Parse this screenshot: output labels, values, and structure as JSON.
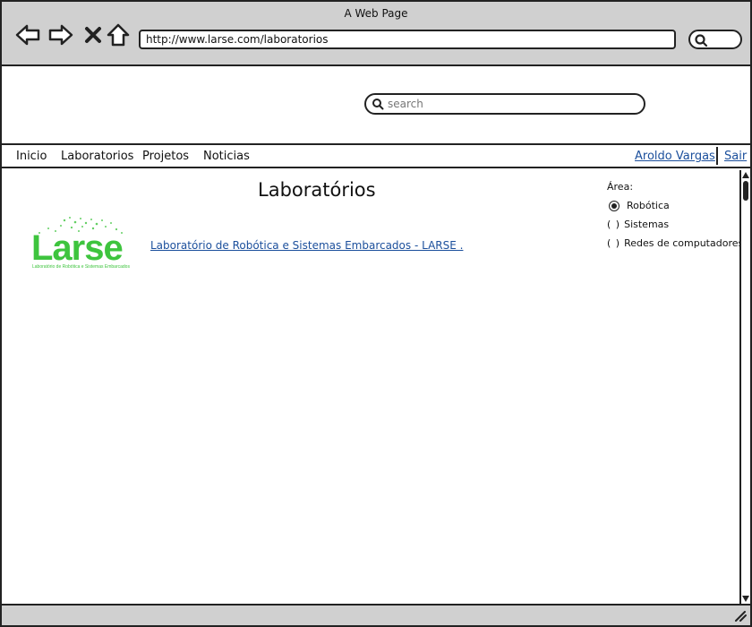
{
  "window": {
    "title": "A Web Page"
  },
  "browser": {
    "url": "http://www.larse.com/laboratorios"
  },
  "search": {
    "placeholder": "search",
    "value": ""
  },
  "menu": {
    "items": [
      "Inicio",
      "Laboratorios",
      "Projetos",
      "Noticias"
    ],
    "user_name": "Aroldo Vargas",
    "logout": "Sair"
  },
  "content": {
    "title": "Laboratórios",
    "logo_text": "Larse",
    "logo_tagline": "Laboratório de Robótica e Sistemas Embarcados",
    "lab_link": "Laboratório de Robótica e Sistemas Embarcados - LARSE .",
    "logo_color": "#3ec43e"
  },
  "filter": {
    "label": "Área:",
    "options": [
      {
        "label": "Robótica",
        "selected": true
      },
      {
        "label": "Sistemas",
        "selected": false
      },
      {
        "label": "Redes de computadores",
        "selected": false
      }
    ]
  },
  "colors": {
    "link": "#1b4f9c",
    "chrome": "#d0d0d0"
  }
}
